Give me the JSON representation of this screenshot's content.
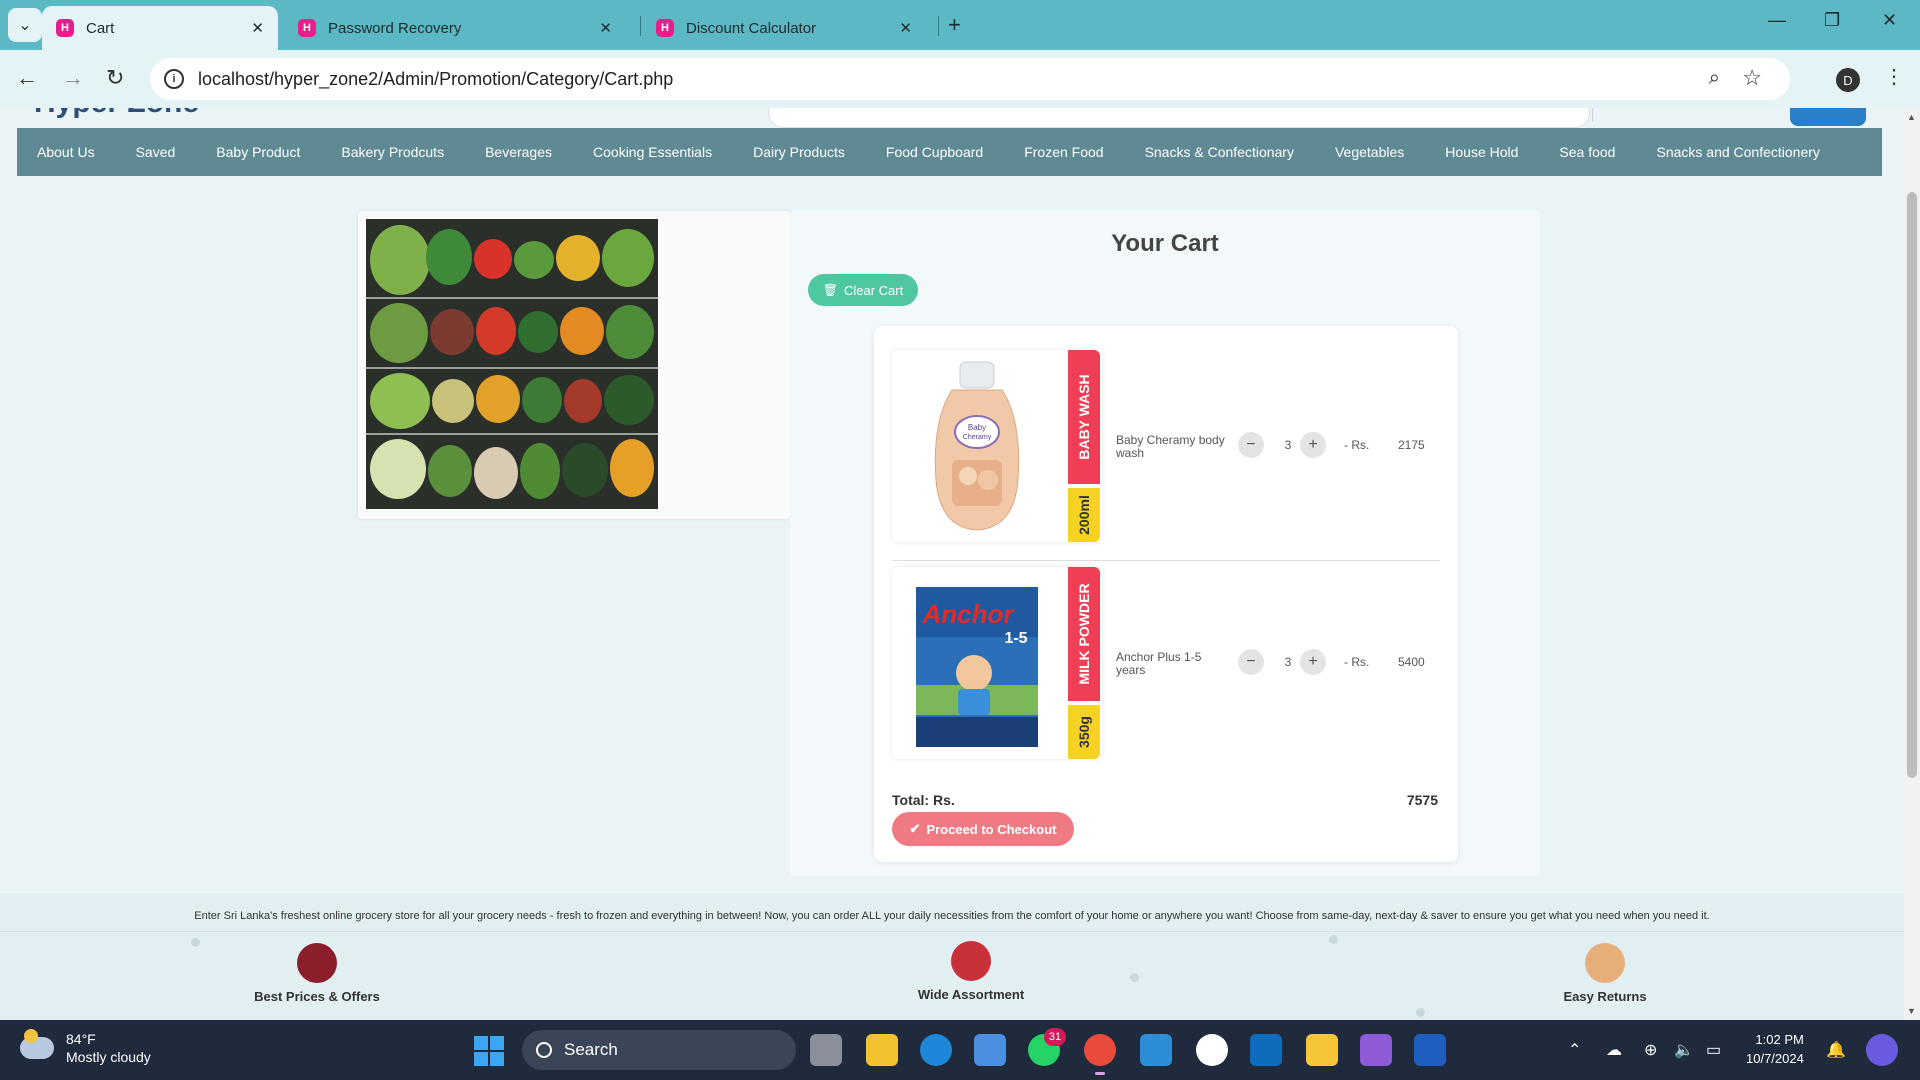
{
  "browser": {
    "tabs": [
      {
        "title": "Cart",
        "active": true
      },
      {
        "title": "Password Recovery",
        "active": false
      },
      {
        "title": "Discount Calculator",
        "active": false
      }
    ],
    "favicon_letter": "H",
    "url": "localhost/hyper_zone2/Admin/Promotion/Category/Cart.php",
    "profile_initial": "D"
  },
  "site": {
    "brand": "Hyper Zone",
    "categories": [
      "About Us",
      "Saved",
      "Baby Product",
      "Bakery Prodcuts",
      "Beverages",
      "Cooking Essentials",
      "Dairy Products",
      "Food Cupboard",
      "Frozen Food",
      "Snacks & Confectionary",
      "Vegetables",
      "House Hold",
      "Sea food",
      "Snacks and Confectionery"
    ]
  },
  "cart": {
    "title": "Your Cart",
    "clear_label": "Clear Cart",
    "rs_label": "- Rs.",
    "items": [
      {
        "name": "Baby Cheramy body wash",
        "category": "BABY WASH",
        "size": "200ml",
        "qty": "3",
        "price": "2175"
      },
      {
        "name": "Anchor Plus 1-5 years",
        "category": "MILK POWDER",
        "size": "350g",
        "qty": "3",
        "price": "5400"
      }
    ],
    "total_label": "Total: Rs.",
    "total_value": "7575",
    "checkout_label": "Proceed to Checkout"
  },
  "footer": {
    "text": "Enter Sri Lanka's freshest online grocery store for all your grocery needs - fresh to frozen and everything in between! Now, you can order ALL your daily necessities from the comfort of your home or anywhere you want! Choose from same-day, next-day & saver to ensure you get what you need when you need it.",
    "features": [
      "Best Prices & Offers",
      "Wide Assortment",
      "Easy Returns"
    ]
  },
  "taskbar": {
    "temperature": "84°F",
    "weather": "Mostly cloudy",
    "search_label": "Search",
    "whatsapp_badge": "31",
    "time": "1:02 PM",
    "date": "10/7/2024"
  }
}
